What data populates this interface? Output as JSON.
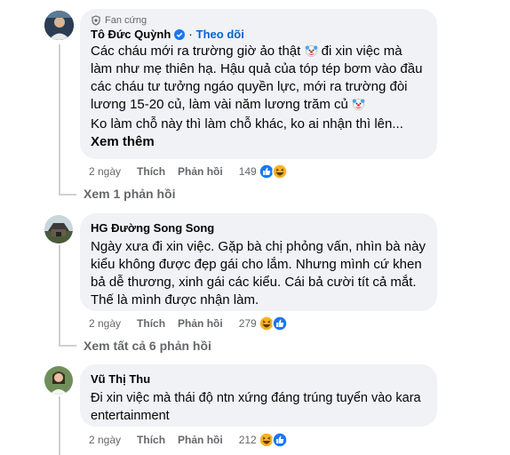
{
  "comments": [
    {
      "badge": "Fan cứng",
      "author": "Tô Đức Quỳnh",
      "separator": "·",
      "follow_label": "Theo dõi",
      "text_parts": [
        "Các cháu mới ra trường giờ ảo thật",
        " đi xin việc mà làm như mẹ thiên hạ. Hậu quả của tóp tép bơm vào đầu các cháu tư tưởng ngáo quyền lực, mới ra trường đòi lương 15-20 củ, làm vài năm lương trăm củ"
      ],
      "text2": "Ko làm chỗ này thì làm chỗ khác, ko ai nhận thì lên...",
      "see_more": "Xem thêm",
      "time": "2 ngày",
      "like_label": "Thích",
      "reply_label": "Phản hồi",
      "reaction_count": "149",
      "replies_link": "Xem 1 phản hồi"
    },
    {
      "author": "HG Đường Song Song",
      "text": "Ngày xưa đi xin việc. Gặp bà chị phỏng vấn, nhìn bà này kiểu không được đẹp gái cho lắm. Nhưng mình cứ khen bả dễ thương, xinh gái các kiểu. Cái bả cười tít cả mắt. Thế là mình được nhận làm.",
      "time": "2 ngày",
      "like_label": "Thích",
      "reply_label": "Phản hồi",
      "reaction_count": "279",
      "replies_link": "Xem tất cả 6 phản hồi"
    },
    {
      "author": "Vũ Thị Thu",
      "text": "Đi xin việc mà thái độ ntn xứng đáng trúng tuyển vào kara entertainment",
      "time": "2 ngày",
      "like_label": "Thích",
      "reply_label": "Phản hồi",
      "reaction_count": "212"
    }
  ],
  "colors": {
    "bubble": "#f0f2f5",
    "link_blue": "#0064d1",
    "muted": "#65676b",
    "like_blue": "#1877f2",
    "haha_yellow": "#f7b125"
  },
  "icons": [
    "fan-badge-icon",
    "verified-icon",
    "clown-emoji-icon",
    "like-reaction-icon",
    "haha-reaction-icon"
  ]
}
